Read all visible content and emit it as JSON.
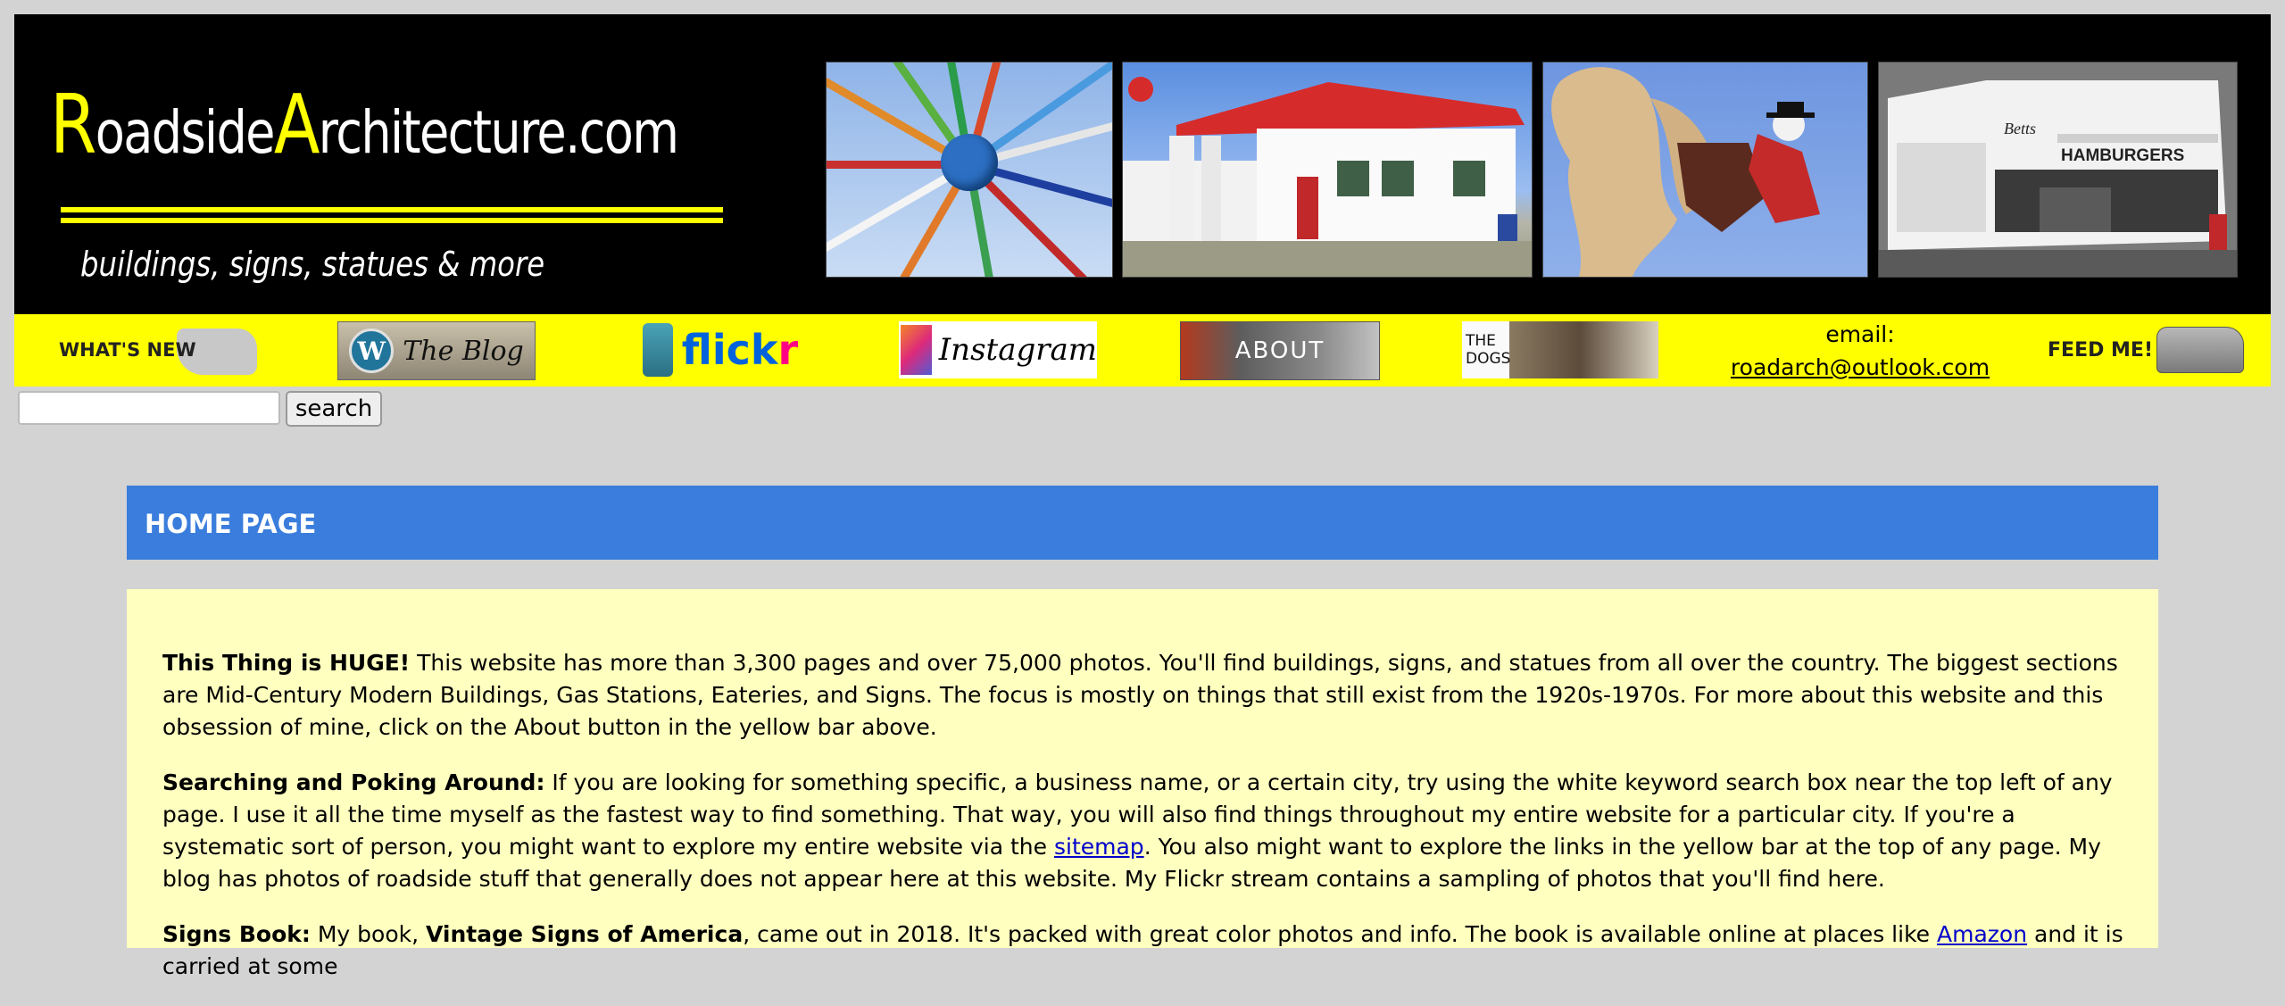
{
  "header": {
    "logo": {
      "title_first_cap": "R",
      "title_first_rest": "oadside",
      "title_second_cap": "A",
      "title_second_rest": "rchitecture.com",
      "tagline": "buildings, signs, statues & more"
    },
    "photos": [
      "pinwheel-sign-photo",
      "gas-station-photo",
      "cowboy-horse-statue-photo",
      "hamburger-stand-photo"
    ],
    "photo_texts": {
      "hamburgers_sign": "HAMBURGERS",
      "hamburgers_script": "Betts"
    }
  },
  "nav": {
    "whats_new": "WHAT'S NEW",
    "blog": "The Blog",
    "flickr_a": "flick",
    "flickr_b": "r",
    "instagram": "Instagram",
    "about": "ABOUT",
    "dogs": "THE DOGS",
    "email_label": "email:",
    "email_address": "roadarch@outlook.com",
    "feed_me": "FEED ME!"
  },
  "search": {
    "input_value": "",
    "button_label": "search"
  },
  "page": {
    "banner_title": "HOME PAGE",
    "p1_head": "This Thing is HUGE!",
    "p1_text": " This website has more than 3,300 pages and over 75,000 photos. You'll find buildings, signs, and statues from all over the country. The biggest sections are Mid-Century Modern Buildings, Gas Stations, Eateries, and Signs. The focus is mostly on things that still exist from the 1920s-1970s. For more about this website and this obsession of mine, click on the About button in the yellow bar above.",
    "p2_head": "Searching and Poking Around:",
    "p2_text_a": " If you are looking for something specific, a business name, or a certain city, try using the white keyword search box near the top left of any page. I use it all the time myself as the fastest way to find something. That way, you will also find things throughout my entire website for a particular city. If you're a systematic sort of person, you might want to explore my entire website via the ",
    "p2_link": "sitemap",
    "p2_text_b": ". You also might want to explore the links in the yellow bar at the top of any page. My blog has photos of roadside stuff that generally does not appear here at this website. My Flickr stream contains a sampling of photos that you'll find here.",
    "p3_head": "Signs Book:",
    "p3_text_a": " My book, ",
    "p3_book": "Vintage Signs of America",
    "p3_text_b": ", came out in 2018. It's packed with great color photos and info. The book is available online at places like ",
    "p3_link": "Amazon",
    "p3_text_c": " and it is carried at some"
  },
  "colors": {
    "header_bg": "#000000",
    "nav_yellow": "#ffff00",
    "banner_blue": "#3a7ddc",
    "content_bg": "#ffffc0",
    "page_bg": "#d3d3d3"
  }
}
